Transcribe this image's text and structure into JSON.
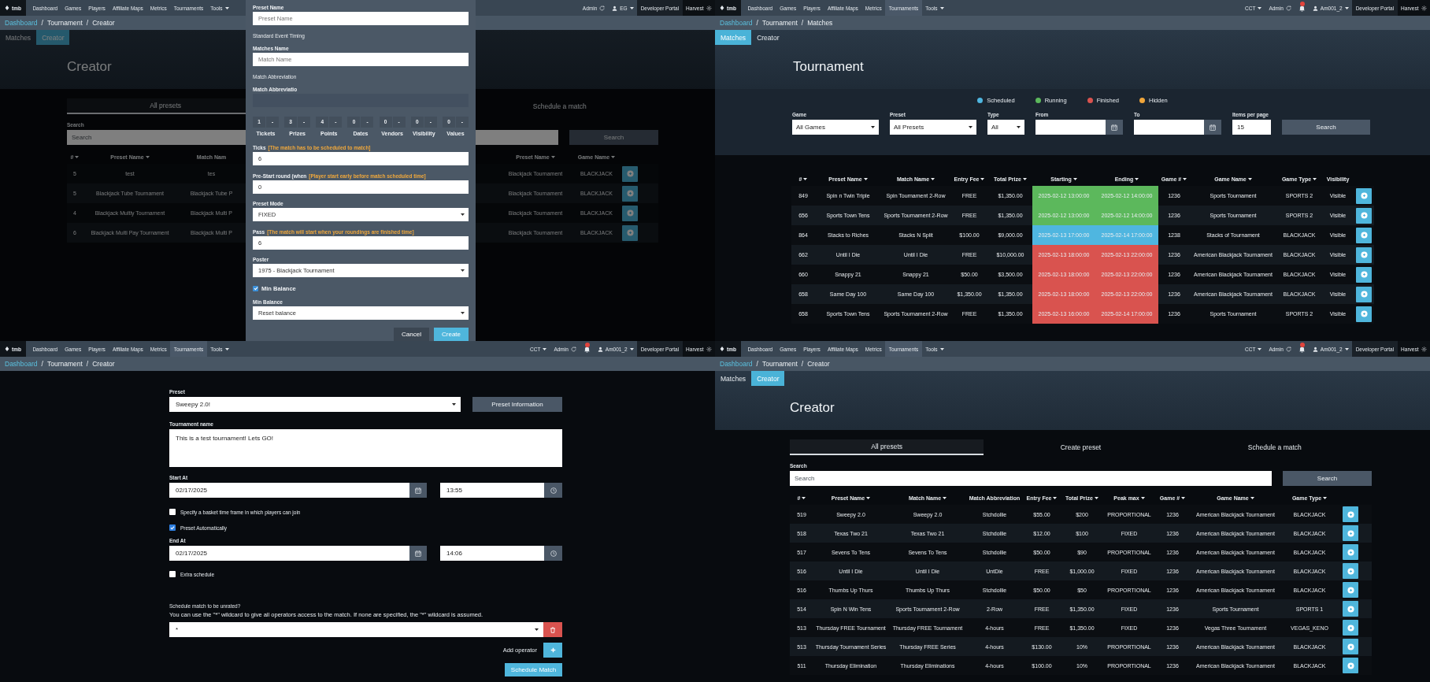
{
  "panels": [
    {
      "kind": "creator_modal",
      "nav": {
        "logo": "tmb",
        "items": [
          {
            "label": "Dashboard",
            "selected": false,
            "dropdown": false
          },
          {
            "label": "Games",
            "selected": false,
            "dropdown": false
          },
          {
            "label": "Players",
            "selected": false,
            "dropdown": false
          },
          {
            "label": "Affiliate Maps",
            "selected": false,
            "dropdown": false
          },
          {
            "label": "Metrics",
            "selected": false,
            "dropdown": false
          },
          {
            "label": "Tournaments",
            "selected": false,
            "dropdown": false
          },
          {
            "label": "Tools",
            "selected": false,
            "dropdown": true
          }
        ],
        "right": [
          {
            "kind": "refresh",
            "label": "Admin"
          },
          {
            "kind": "account",
            "label": "EG"
          },
          {
            "kind": "portal",
            "label": "Developer Portal"
          },
          {
            "kind": "gear",
            "label": "Harvest"
          }
        ]
      },
      "breadcrumb": [
        {
          "kind": "link",
          "text": "Dashboard"
        },
        {
          "kind": "sep",
          "text": "/"
        },
        {
          "kind": "current",
          "text": "Tournament"
        },
        {
          "kind": "sep",
          "text": "/"
        },
        {
          "kind": "current",
          "text": "Creator"
        }
      ],
      "subtabs": [
        {
          "label": "Matches",
          "selected": false
        },
        {
          "label": "Creator",
          "selected": true
        }
      ],
      "heading": "Creator",
      "tabs": [
        {
          "label": "All presets",
          "selected": true
        },
        {
          "label": "Schedule a match",
          "selected": false
        }
      ],
      "search": {
        "label": "Search",
        "placeholder": "Search",
        "button": "Search"
      },
      "table": {
        "columns": [
          {
            "label": "#",
            "sortable": true,
            "kind": "text"
          },
          {
            "label": "Preset Name",
            "sortable": true,
            "kind": "text"
          },
          {
            "label": "Match Nam",
            "sortable": false,
            "kind": "text"
          },
          {
            "label": "Preset Name",
            "sortable": true,
            "kind": "text"
          },
          {
            "label": "Game Name",
            "sortable": true,
            "kind": "text"
          }
        ],
        "rows": [
          {
            "cells": [
              "5",
              "test",
              "tes",
              "Blackjack Tournament",
              "BLACKJACK"
            ]
          },
          {
            "cells": [
              "5",
              "Blackjack Tube Tournament",
              "Blackjack Tube P",
              "Blackjack Tournament",
              "BLACKJACK"
            ]
          },
          {
            "cells": [
              "4",
              "Blackjack Multly Tournament",
              "Blackjack Multi P",
              "Blackjack Tournament",
              "BLACKJACK"
            ]
          },
          {
            "cells": [
              "6",
              "Blackjack Multi Pay Tournament",
              "Blackjack Multi P",
              "Blackjack Tournament",
              "BLACKJACK"
            ]
          }
        ]
      },
      "modal": {
        "fields": [
          {
            "kind": "text",
            "label": "Preset Name",
            "placeholder": "Preset Name"
          },
          {
            "kind": "helper",
            "text": "Standard Event Timing"
          },
          {
            "kind": "text",
            "label": "Matches Name",
            "placeholder": "Match Name"
          },
          {
            "kind": "helper",
            "text": "Match Abbreviation"
          },
          {
            "kind": "dark",
            "label": "Match Abbreviatio"
          },
          {
            "kind": "steps",
            "steps": [
              {
                "value": "1",
                "suffix": "-",
                "label": "Tickets"
              },
              {
                "value": "3",
                "suffix": "-",
                "label": "Prizes"
              },
              {
                "value": "4",
                "suffix": "-",
                "label": "Points"
              },
              {
                "value": "0",
                "suffix": "-",
                "label": "Dates"
              },
              {
                "value": "0",
                "suffix": "-",
                "label": "Vendors"
              },
              {
                "value": "0",
                "suffix": "-",
                "label": "Visibility"
              },
              {
                "value": "0",
                "suffix": "-",
                "label": "Values"
              }
            ]
          },
          {
            "kind": "text",
            "label": "Ticks",
            "hint": "[The match has to be scheduled to match]",
            "value": "6"
          },
          {
            "kind": "text",
            "label": "Pre-Start round (when",
            "hint": "[Player start early before match scheduled time]",
            "value": "0"
          },
          {
            "kind": "select",
            "label": "Preset Mode",
            "value": "FIXED"
          },
          {
            "kind": "text",
            "label": "Pass",
            "hint": "[The match will start when your roundings are finished time]",
            "value": "6"
          },
          {
            "kind": "select",
            "label": "Poster",
            "value": "1975 - Blackjack Tournament"
          },
          {
            "kind": "checkbox",
            "label": "Min Balance",
            "checked": true
          },
          {
            "kind": "select",
            "label": "Min Balance",
            "value": "Reset balance"
          }
        ],
        "buttons": [
          {
            "label": "Cancel",
            "kind": "secondary"
          },
          {
            "label": "Create",
            "kind": "primary"
          }
        ]
      }
    },
    {
      "kind": "matches",
      "nav": {
        "logo": "tmb",
        "items": [
          {
            "label": "Dashboard",
            "selected": false,
            "dropdown": false
          },
          {
            "label": "Games",
            "selected": false,
            "dropdown": false
          },
          {
            "label": "Players",
            "selected": false,
            "dropdown": false
          },
          {
            "label": "Affiliate Maps",
            "selected": false,
            "dropdown": false
          },
          {
            "label": "Metrics",
            "selected": false,
            "dropdown": false
          },
          {
            "label": "Tournaments",
            "selected": true,
            "dropdown": false
          },
          {
            "label": "Tools",
            "selected": false,
            "dropdown": true
          }
        ],
        "right": [
          {
            "kind": "dropdown",
            "label": "CCT"
          },
          {
            "kind": "refresh",
            "label": "Admin"
          },
          {
            "kind": "bell"
          },
          {
            "kind": "account",
            "label": "Am001_2"
          },
          {
            "kind": "portal",
            "label": "Developer Portal"
          },
          {
            "kind": "gear",
            "label": "Harvest"
          }
        ]
      },
      "breadcrumb": [
        {
          "kind": "link",
          "text": "Dashboard"
        },
        {
          "kind": "sep",
          "text": "/"
        },
        {
          "kind": "current",
          "text": "Tournament"
        },
        {
          "kind": "sep",
          "text": "/"
        },
        {
          "kind": "current",
          "text": "Matches"
        }
      ],
      "subtabs": [
        {
          "label": "Matches",
          "selected": true
        },
        {
          "label": "Creator",
          "selected": false
        }
      ],
      "heading": "Tournament",
      "legend": [
        {
          "label": "Scheduled",
          "color": "#4fb6e0"
        },
        {
          "label": "Running",
          "color": "#5cb85c"
        },
        {
          "label": "Finished",
          "color": "#d9534f"
        },
        {
          "label": "Hidden",
          "color": "#f0a53a"
        }
      ],
      "filters": [
        {
          "kind": "select",
          "label": "Game",
          "value": "All Games"
        },
        {
          "kind": "select",
          "label": "Preset",
          "value": "All Presets"
        },
        {
          "kind": "select",
          "label": "Type",
          "value": "All"
        },
        {
          "kind": "date",
          "label": "From"
        },
        {
          "kind": "date",
          "label": "To"
        },
        {
          "kind": "text",
          "label": "Items per page",
          "value": "15"
        }
      ],
      "filter_button": "Search",
      "table": {
        "columns": [
          {
            "label": "#",
            "sortable": true,
            "kind": "text"
          },
          {
            "label": "Preset Name",
            "sortable": true,
            "kind": "text"
          },
          {
            "label": "Match Name",
            "sortable": true,
            "kind": "text"
          },
          {
            "label": "Entry Fee",
            "sortable": true,
            "kind": "text"
          },
          {
            "label": "Total Prize",
            "sortable": true,
            "kind": "text"
          },
          {
            "label": "Starting",
            "sortable": true,
            "kind": "status"
          },
          {
            "label": "Ending",
            "sortable": true,
            "kind": "status"
          },
          {
            "label": "Game #",
            "sortable": true,
            "kind": "text"
          },
          {
            "label": "Game Name",
            "sortable": true,
            "kind": "text"
          },
          {
            "label": "Game Type",
            "sortable": true,
            "kind": "text"
          },
          {
            "label": "Visibility",
            "sortable": false,
            "kind": "text"
          }
        ],
        "rows": [
          {
            "color": "#5cb85c",
            "cells": [
              "849",
              "Spin n Twin Triple",
              "Spin Tournament 2-Row",
              "FREE",
              "$1,350.00",
              "2025-02-12 13:00:00",
              "2025-02-12 14:00:00",
              "1236",
              "Sports Tournament",
              "SPORTS 2",
              "Visible"
            ]
          },
          {
            "color": "#5cb85c",
            "cells": [
              "656",
              "Sports Town Tens",
              "Sports Tournament 2-Row",
              "FREE",
              "$1,350.00",
              "2025-02-12 13:00:00",
              "2025-02-12 14:00:00",
              "1236",
              "Sports Tournament",
              "SPORTS 2",
              "Visible"
            ]
          },
          {
            "color": "#4fb6e0",
            "cells": [
              "864",
              "Stacks to Riches",
              "Stacks N Split",
              "$100.00",
              "$9,000.00",
              "2025-02-13 17:00:00",
              "2025-02-14 17:00:00",
              "1238",
              "Stacks of Tournament",
              "BLACKJACK",
              "Visible"
            ]
          },
          {
            "color": "#d9534f",
            "cells": [
              "662",
              "Until I Die",
              "Until I Die",
              "FREE",
              "$10,000.00",
              "2025-02-13 18:00:00",
              "2025-02-13 22:00:00",
              "1236",
              "American Blackjack Tournament",
              "BLACKJACK",
              "Visible"
            ]
          },
          {
            "color": "#d9534f",
            "cells": [
              "660",
              "Snappy 21",
              "Snappy 21",
              "$50.00",
              "$3,500.00",
              "2025-02-13 18:00:00",
              "2025-02-13 22:00:00",
              "1236",
              "American Blackjack Tournament",
              "BLACKJACK",
              "Visible"
            ]
          },
          {
            "color": "#d9534f",
            "cells": [
              "658",
              "Same Day 100",
              "Same Day 100",
              "$1,350.00",
              "$1,350.00",
              "2025-02-13 18:00:00",
              "2025-02-13 22:00:00",
              "1236",
              "American Blackjack Tournament",
              "BLACKJACK",
              "Visible"
            ]
          },
          {
            "color": "#d9534f",
            "cells": [
              "658",
              "Sports Town Tens",
              "Sports Tournament 2-Row",
              "FREE",
              "$1,350.00",
              "2025-02-13 16:00:00",
              "2025-02-14 17:00:00",
              "1236",
              "Sports Tournament",
              "SPORTS 2",
              "Visible"
            ]
          }
        ]
      }
    },
    {
      "kind": "schedule",
      "nav": {
        "logo": "tmb",
        "items": [
          {
            "label": "Dashboard",
            "selected": false,
            "dropdown": false
          },
          {
            "label": "Games",
            "selected": false,
            "dropdown": false
          },
          {
            "label": "Players",
            "selected": false,
            "dropdown": false
          },
          {
            "label": "Affiliate Maps",
            "selected": false,
            "dropdown": false
          },
          {
            "label": "Metrics",
            "selected": false,
            "dropdown": false
          },
          {
            "label": "Tournaments",
            "selected": true,
            "dropdown": false
          },
          {
            "label": "Tools",
            "selected": false,
            "dropdown": true
          }
        ],
        "right": [
          {
            "kind": "dropdown",
            "label": "CCT"
          },
          {
            "kind": "refresh",
            "label": "Admin"
          },
          {
            "kind": "bell"
          },
          {
            "kind": "account",
            "label": "Am001_2"
          },
          {
            "kind": "portal",
            "label": "Developer Portal"
          },
          {
            "kind": "gear",
            "label": "Harvest"
          }
        ]
      },
      "breadcrumb": [
        {
          "kind": "link",
          "text": "Dashboard"
        },
        {
          "kind": "sep",
          "text": "/"
        },
        {
          "kind": "current",
          "text": "Tournament"
        },
        {
          "kind": "sep",
          "text": "/"
        },
        {
          "kind": "current",
          "text": "Creator"
        }
      ],
      "form": {
        "preset": {
          "label": "Preset",
          "value": "Sweepy 2.0!",
          "button": "Preset Information"
        },
        "name": {
          "label": "Tournament name",
          "value": "This is a test tournament! Lets GO!"
        },
        "start": {
          "label": "Start At",
          "date": "02/17/2025",
          "time": "13:55"
        },
        "options": [
          {
            "label": "Specify a basket time frame in which players can join",
            "checked": false
          },
          {
            "label": "Preset Automatically",
            "checked": true
          }
        ],
        "end": {
          "label": "End At",
          "date": "02/17/2025",
          "time": "14:06"
        },
        "extra": {
          "label": "Extra schedule",
          "checked": false
        },
        "operators": {
          "label": "Schedule match to be unrated?",
          "text": "You can use the \"*\" wildcard to give all operators access to the match. If none are specified, the \"*\" wildcard is assumed.",
          "values": [
            "*"
          ],
          "add": "Add operator"
        },
        "submit": "Schedule Match"
      }
    },
    {
      "kind": "creator",
      "nav": {
        "logo": "tmb",
        "items": [
          {
            "label": "Dashboard",
            "selected": false,
            "dropdown": false
          },
          {
            "label": "Games",
            "selected": false,
            "dropdown": false
          },
          {
            "label": "Players",
            "selected": false,
            "dropdown": false
          },
          {
            "label": "Affiliate Maps",
            "selected": false,
            "dropdown": false
          },
          {
            "label": "Metrics",
            "selected": false,
            "dropdown": false
          },
          {
            "label": "Tournaments",
            "selected": true,
            "dropdown": false
          },
          {
            "label": "Tools",
            "selected": false,
            "dropdown": true
          }
        ],
        "right": [
          {
            "kind": "dropdown",
            "label": "CCT"
          },
          {
            "kind": "refresh",
            "label": "Admin"
          },
          {
            "kind": "bell"
          },
          {
            "kind": "account",
            "label": "Am001_2"
          },
          {
            "kind": "portal",
            "label": "Developer Portal"
          },
          {
            "kind": "gear",
            "label": "Harvest"
          }
        ]
      },
      "breadcrumb": [
        {
          "kind": "link",
          "text": "Dashboard"
        },
        {
          "kind": "sep",
          "text": "/"
        },
        {
          "kind": "current",
          "text": "Tournament"
        },
        {
          "kind": "sep",
          "text": "/"
        },
        {
          "kind": "current",
          "text": "Creator"
        }
      ],
      "subtabs": [
        {
          "label": "Matches",
          "selected": false
        },
        {
          "label": "Creator",
          "selected": true
        }
      ],
      "heading": "Creator",
      "tabs": [
        {
          "label": "All presets",
          "selected": true
        },
        {
          "label": "Create preset",
          "selected": false
        },
        {
          "label": "Schedule a match",
          "selected": false
        }
      ],
      "search": {
        "label": "Search",
        "placeholder": "Search",
        "button": "Search"
      },
      "table": {
        "columns": [
          {
            "label": "#",
            "sortable": true,
            "kind": "text"
          },
          {
            "label": "Preset Name",
            "sortable": true,
            "kind": "text"
          },
          {
            "label": "Match Name",
            "sortable": true,
            "kind": "text"
          },
          {
            "label": "Match Abbreviation",
            "sortable": false,
            "kind": "text"
          },
          {
            "label": "Entry Fee",
            "sortable": true,
            "kind": "text"
          },
          {
            "label": "Total Prize",
            "sortable": true,
            "kind": "text"
          },
          {
            "label": "Peak max",
            "sortable": true,
            "kind": "text"
          },
          {
            "label": "Game #",
            "sortable": true,
            "kind": "text"
          },
          {
            "label": "Game Name",
            "sortable": true,
            "kind": "text"
          },
          {
            "label": "Game Type",
            "sortable": true,
            "kind": "text"
          }
        ],
        "rows": [
          {
            "cells": [
              "519",
              "Sweepy 2.0",
              "Sweepy 2.0",
              "Stchdollie",
              "$55.00",
              "$200",
              "PROPORTIONAL",
              "1236",
              "American Blackjack Tournament",
              "BLACKJACK"
            ]
          },
          {
            "cells": [
              "518",
              "Texas Two 21",
              "Texas Two 21",
              "Stchdollie",
              "$12.00",
              "$100",
              "FIXED",
              "1236",
              "American Blackjack Tournament",
              "BLACKJACK"
            ]
          },
          {
            "cells": [
              "517",
              "Sevens To Tens",
              "Sevens To Tens",
              "Stchdollie",
              "$50.00",
              "$90",
              "PROPORTIONAL",
              "1236",
              "American Blackjack Tournament",
              "BLACKJACK"
            ]
          },
          {
            "cells": [
              "516",
              "Until I Die",
              "Until I Die",
              "UntDie",
              "FREE",
              "$1,000.00",
              "FIXED",
              "1236",
              "American Blackjack Tournament",
              "BLACKJACK"
            ]
          },
          {
            "cells": [
              "516",
              "Thumbs Up Thurs",
              "Thumbs Up Thurs",
              "Stchdollie",
              "$50.00",
              "$50",
              "PROPORTIONAL",
              "1236",
              "American Blackjack Tournament",
              "BLACKJACK"
            ]
          },
          {
            "cells": [
              "514",
              "Spin N Win Tens",
              "Sports Tournament 2-Row",
              "2-Row",
              "FREE",
              "$1,350.00",
              "FIXED",
              "1236",
              "Sports Tournament",
              "SPORTS 1"
            ]
          },
          {
            "cells": [
              "513",
              "Thursday FREE Tournament",
              "Thursday FREE Tournament",
              "4-hours",
              "FREE",
              "$1,350.00",
              "FIXED",
              "1236",
              "Vegas Three Tournament",
              "VEGAS_KENO"
            ]
          },
          {
            "cells": [
              "513",
              "Thursday Tournament Series",
              "Thursday FREE Series",
              "4-hours",
              "$130.00",
              "10%",
              "PROPORTIONAL",
              "1236",
              "American Blackjack Tournament",
              "BLACKJACK"
            ]
          },
          {
            "cells": [
              "511",
              "Thursday Elimination",
              "Thursday Eliminations",
              "4-hours",
              "$100.00",
              "10%",
              "PROPORTIONAL",
              "1236",
              "American Blackjack Tournament",
              "BLACKJACK"
            ]
          }
        ]
      }
    }
  ]
}
